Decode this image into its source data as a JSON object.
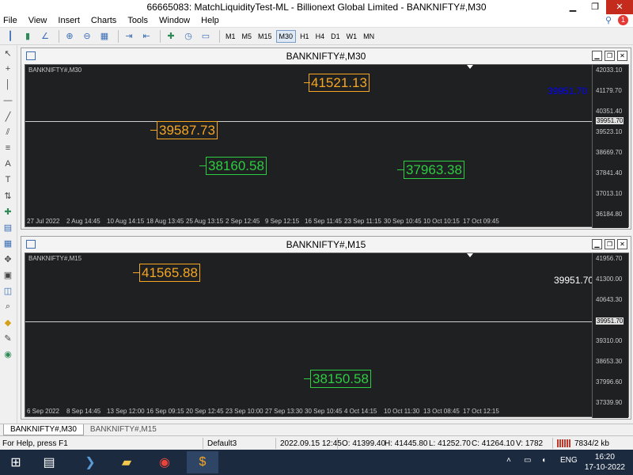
{
  "window": {
    "title": "66665083: MatchLiquidityTest-ML - Billionext Global Limited - BANKNIFTY#,M30",
    "minimize": "▁",
    "restore": "❐",
    "close": "✕"
  },
  "menu": {
    "items": [
      "File",
      "View",
      "Insert",
      "Charts",
      "Tools",
      "Window",
      "Help"
    ],
    "notification_count": "1"
  },
  "toolbar": {
    "timeframes": [
      "M1",
      "M5",
      "M15",
      "M30",
      "H1",
      "H4",
      "D1",
      "W1",
      "MN"
    ],
    "active_timeframe": "M30"
  },
  "charts": [
    {
      "title": "BANKNIFTY#,M30",
      "symbol_tag": "BANKNIFTY#,M30",
      "current_price": "39951.70",
      "current_price_color": "#0000ff",
      "labels": [
        {
          "text": "41521.13",
          "color": "orange"
        },
        {
          "text": "39587.73",
          "color": "orange"
        },
        {
          "text": "38160.58",
          "color": "green"
        },
        {
          "text": "37963.38",
          "color": "green"
        }
      ],
      "y_axis": [
        "42033.10",
        "41179.70",
        "40351.40",
        "39951.70",
        "39523.10",
        "38669.70",
        "37841.40",
        "37013.10",
        "36184.80"
      ],
      "x_axis": [
        "27 Jul 2022",
        "2 Aug 14:45",
        "10 Aug 14:15",
        "18 Aug 13:45",
        "25 Aug 13:15",
        "2 Sep 12:45",
        "9 Sep 12:15",
        "16 Sep 11:45",
        "23 Sep 11:15",
        "30 Sep 10:45",
        "10 Oct 10:15",
        "17 Oct 09:45"
      ]
    },
    {
      "title": "BANKNIFTY#,M15",
      "symbol_tag": "BANKNIFTY#,M15",
      "current_price": "39951.70",
      "current_price_color": "#ffffff",
      "labels": [
        {
          "text": "41565.88",
          "color": "orange"
        },
        {
          "text": "38150.58",
          "color": "green"
        }
      ],
      "y_axis": [
        "41956.70",
        "41300.00",
        "40643.30",
        "39951.70",
        "39310.00",
        "38653.30",
        "37996.60",
        "37339.90"
      ],
      "x_axis": [
        "6 Sep 2022",
        "8 Sep 14:45",
        "13 Sep 12:00",
        "16 Sep 09:15",
        "20 Sep 12:45",
        "23 Sep 10:00",
        "27 Sep 13:30",
        "30 Sep 10:45",
        "4 Oct 14:15",
        "10 Oct 11:30",
        "13 Oct 08:45",
        "17 Oct 12:15"
      ]
    }
  ],
  "tabs": [
    "BANKNIFTY#,M30",
    "BANKNIFTY#,M15"
  ],
  "status": {
    "help": "For Help, press F1",
    "profile": "Default3",
    "datetime": "2022.09.15 12:45",
    "open": "O: 41399.40",
    "high": "H: 41445.80",
    "low": "L: 41252.70",
    "close": "C: 41264.10",
    "volume": "V: 1782",
    "traffic": "7834/2 kb"
  },
  "taskbar": {
    "lang": "ENG",
    "time": "16:20",
    "date": "17-10-2022"
  }
}
